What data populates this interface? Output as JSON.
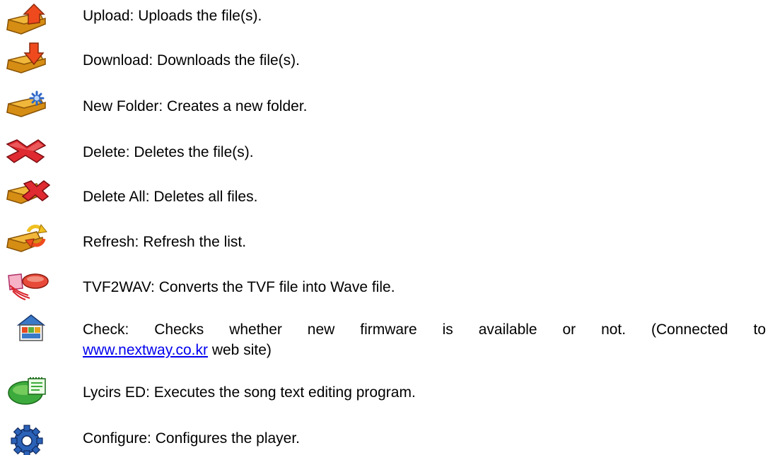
{
  "toolbar_help": {
    "items": [
      {
        "icon": "folder-upload-icon",
        "text": "Upload: Uploads the file(s)."
      },
      {
        "icon": "folder-download-icon",
        "text": "Download: Downloads the file(s)."
      },
      {
        "icon": "new-folder-icon",
        "text": "New Folder: Creates a new folder."
      },
      {
        "icon": "delete-icon",
        "text": "Delete: Deletes the file(s)."
      },
      {
        "icon": "delete-all-icon",
        "text": "Delete All: Deletes all files."
      },
      {
        "icon": "refresh-icon",
        "text": "Refresh: Refresh the list."
      },
      {
        "icon": "tvf2wav-icon",
        "text": "TVF2WAV: Converts the TVF file into Wave file."
      },
      {
        "icon": "firmware-check-icon",
        "text_line1": "Check: Checks whether new firmware is available or not. (Connected to",
        "link_text": "www.nextway.co.kr",
        "text_after_link": " web site)"
      },
      {
        "icon": "lyrics-editor-icon",
        "text": "Lycirs ED: Executes the song text editing program."
      },
      {
        "icon": "gear-icon",
        "text": "Configure: Configures the player."
      }
    ]
  },
  "colors": {
    "folder": "#e8a31c",
    "folder_dark": "#b06d0a",
    "arrow_red": "#e8401c",
    "delete_red": "#d8222a",
    "link": "#0000ee"
  }
}
